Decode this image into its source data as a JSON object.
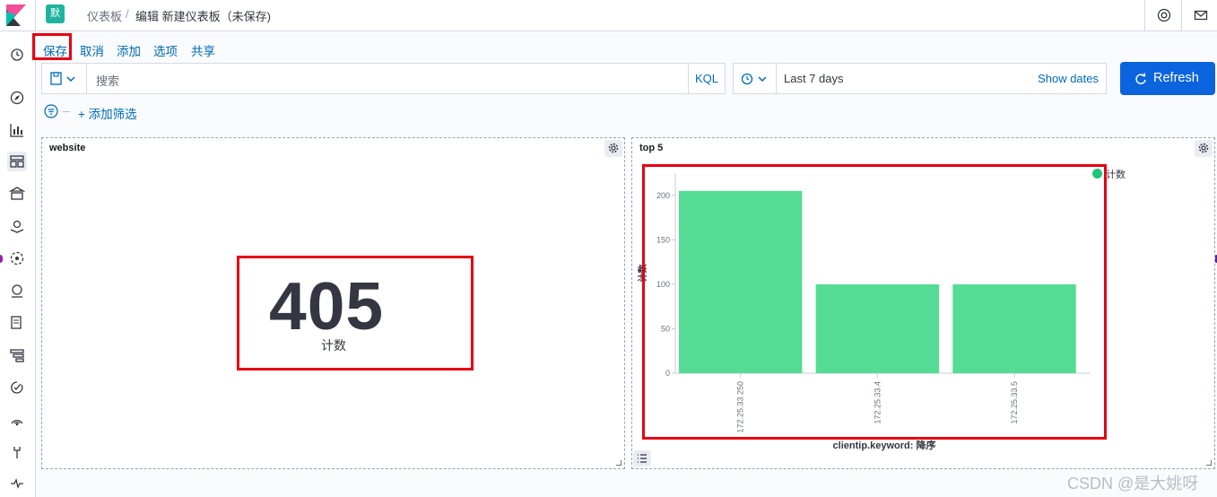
{
  "header": {
    "space_initial": "默",
    "breadcrumb_root": "仪表板",
    "breadcrumb_separator": "/",
    "breadcrumb_current": "编辑 新建仪表板（未保存)"
  },
  "menu": {
    "save": "保存",
    "cancel": "取消",
    "add": "添加",
    "options": "选项",
    "share": "共享"
  },
  "query": {
    "placeholder": "搜索",
    "language": "KQL"
  },
  "time": {
    "range": "Last 7 days",
    "show_dates": "Show dates",
    "refresh": "Refresh"
  },
  "filters": {
    "add": "+ 添加筛选"
  },
  "panels": {
    "website": {
      "title": "website",
      "metric_value": "405",
      "metric_label": "计数"
    },
    "top5": {
      "title": "top 5"
    }
  },
  "chart_data": {
    "type": "bar",
    "categories": [
      "172.25.33.250",
      "172.25.33.4",
      "172.25.33.5"
    ],
    "series": [
      {
        "name": "计数",
        "values": [
          205,
          100,
          100
        ],
        "color": "#54dc94"
      }
    ],
    "ylabel": "计数",
    "xlabel": "clientip.keyword: 降序",
    "ylim": [
      0,
      225
    ],
    "yticks": [
      0,
      50,
      100,
      150,
      200
    ],
    "legend_position": "top-right",
    "legend_dot_color": "#20c57a"
  },
  "watermark": "CSDN @是大姚呀",
  "colors": {
    "accent": "#006bb4",
    "refresh_button": "#0b64dd",
    "highlight_box": "#e60012",
    "space_avatar": "#1fb39e"
  }
}
